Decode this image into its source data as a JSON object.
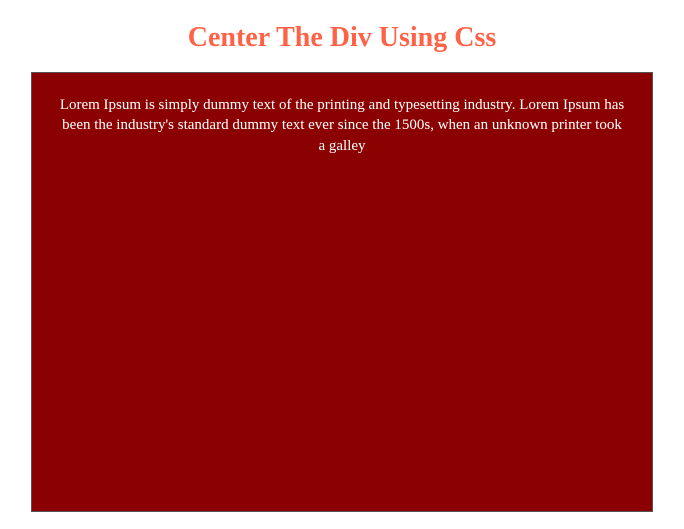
{
  "title": "Center The Div Using Css",
  "paragraph": "Lorem Ipsum is simply dummy text of the printing and typesetting industry. Lorem Ipsum has been the industry's standard dummy text ever since the 1500s, when an unknown printer took a galley",
  "colors": {
    "accent": "#ff6347",
    "box_bg": "#8b0000",
    "text": "#ffffff"
  }
}
